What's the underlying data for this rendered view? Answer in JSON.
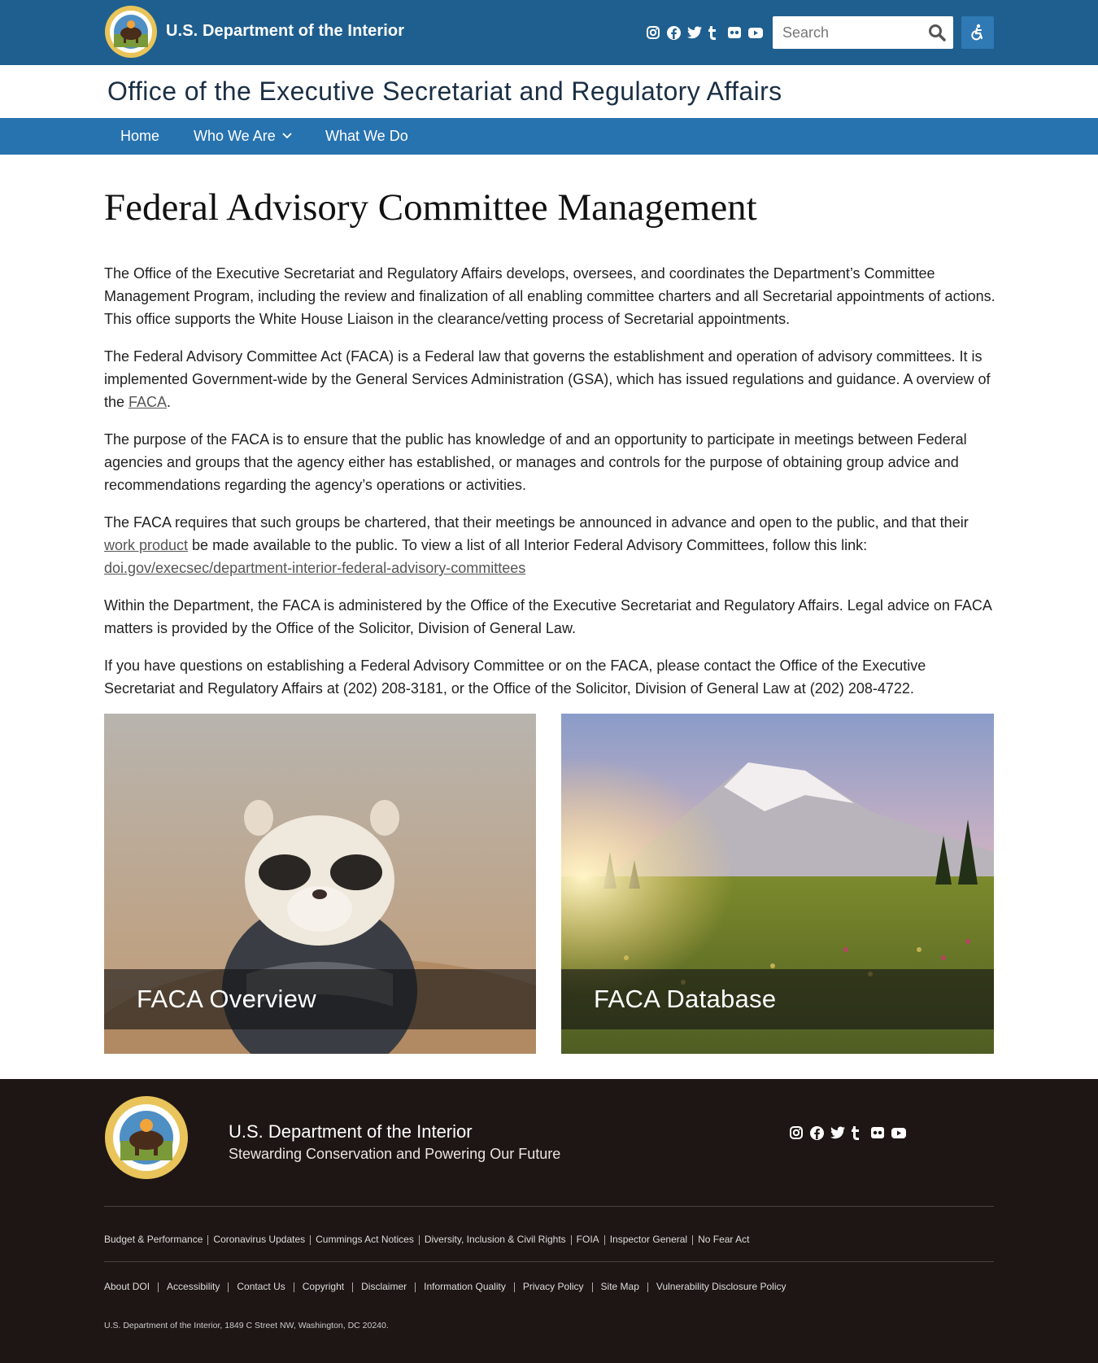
{
  "header": {
    "brand": "U.S. Department of the Interior",
    "search_placeholder": "Search",
    "social_icons": [
      "instagram-icon",
      "facebook-icon",
      "twitter-icon",
      "tumblr-icon",
      "flickr-icon",
      "youtube-icon"
    ],
    "colors": {
      "bar": "#1f5f8f",
      "nav": "#2773b0",
      "accessibility_button": "#2f79b5"
    }
  },
  "office": {
    "title": "Office of the Executive Secretariat and Regulatory Affairs"
  },
  "nav": {
    "home": "Home",
    "who_we_are": "Who We Are",
    "what_we_do": "What We Do"
  },
  "main": {
    "title": "Federal Advisory Committee Management",
    "p1": "The Office of the Executive Secretariat and Regulatory Affairs develops, oversees, and coordinates the Department’s Committee Management Program, including the review and finalization of all enabling committee charters and all Secretarial appointments of actions. This office supports the White House Liaison in the clearance/vetting process of Secretarial appointments.",
    "p2_before": "The Federal Advisory Committee Act (FACA) is a Federal law that governs the establishment and operation of advisory committees. It is implemented Government-wide by the General Services Administration (GSA), which has issued regulations and guidance. A overview of the ",
    "p2_link": "FACA",
    "p2_after": ".",
    "p3": "The purpose of the FACA is to ensure that the public has knowledge of and an opportunity to participate in meetings between Federal agencies and groups that the agency either has established, or manages and controls for the purpose of obtaining group advice and recommendations regarding the agency’s operations or activities.",
    "p4_before": "The FACA requires that such groups be chartered, that their meetings be announced in advance and open to the public, and that their ",
    "p4_link1": "work product",
    "p4_mid": " be made available to the public.  To view a list of all Interior Federal Advisory Committees, follow this link: ",
    "p4_link2": "doi.gov/execsec/department-interior-federal-advisory-committees",
    "p5": "Within the Department, the FACA is administered by the Office of the Executive Secretariat and Regulatory Affairs.  Legal advice on FACA matters is provided by the Office of the Solicitor, Division of General Law.",
    "p6": "If you have questions on establishing a Federal Advisory Committee or on the FACA, please contact the Office of the Executive Secretariat and Regulatory Affairs at (202) 208-3181, or the Office of the Solicitor, Division of General Law at (202) 208-4722."
  },
  "cards": [
    {
      "label": "FACA Overview"
    },
    {
      "label": "FACA Database"
    }
  ],
  "footer": {
    "name": "U.S. Department of the Interior",
    "tagline": "Stewarding Conservation and Powering Our Future",
    "links_row1": [
      "Budget & Performance",
      "Coronavirus Updates",
      "Cummings Act Notices",
      "Diversity, Inclusion & Civil Rights",
      "FOIA",
      "Inspector General",
      "No Fear Act"
    ],
    "links_row2": [
      "About DOI",
      "Accessibility",
      "Contact Us",
      "Copyright",
      "Disclaimer",
      "Information Quality",
      "Privacy Policy",
      "Site Map",
      "Vulnerability Disclosure Policy"
    ],
    "address": "U.S. Department of the Interior, 1849 C Street NW, Washington, DC 20240.",
    "colors": {
      "background": "#1e1614"
    }
  }
}
